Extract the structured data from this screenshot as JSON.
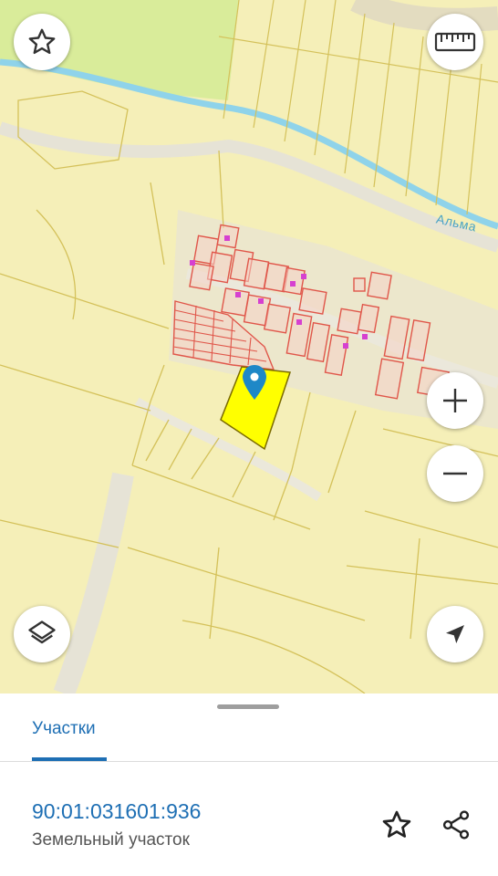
{
  "map": {
    "river_label": "Альма",
    "colors": {
      "land": "#f5efb8",
      "field": "#d9ec9a",
      "parcel_outline": "#d4c15a",
      "building_outline": "#e0564a",
      "selected_parcel": "#ffff00",
      "river": "#8fd3ea",
      "road": "#e6e3d6",
      "pin": "#1e88c7"
    },
    "controls": {
      "favorite_icon": "star-icon",
      "ruler_icon": "ruler-icon",
      "zoom_in_icon": "plus-icon",
      "zoom_out_icon": "minus-icon",
      "layers_icon": "layers-icon",
      "location_icon": "navigation-arrow-icon"
    }
  },
  "sheet": {
    "tab_label": "Участки",
    "parcel_id": "90:01:031601:936",
    "parcel_type": "Земельный участок",
    "star_icon": "star-outline-icon",
    "share_icon": "share-icon"
  }
}
